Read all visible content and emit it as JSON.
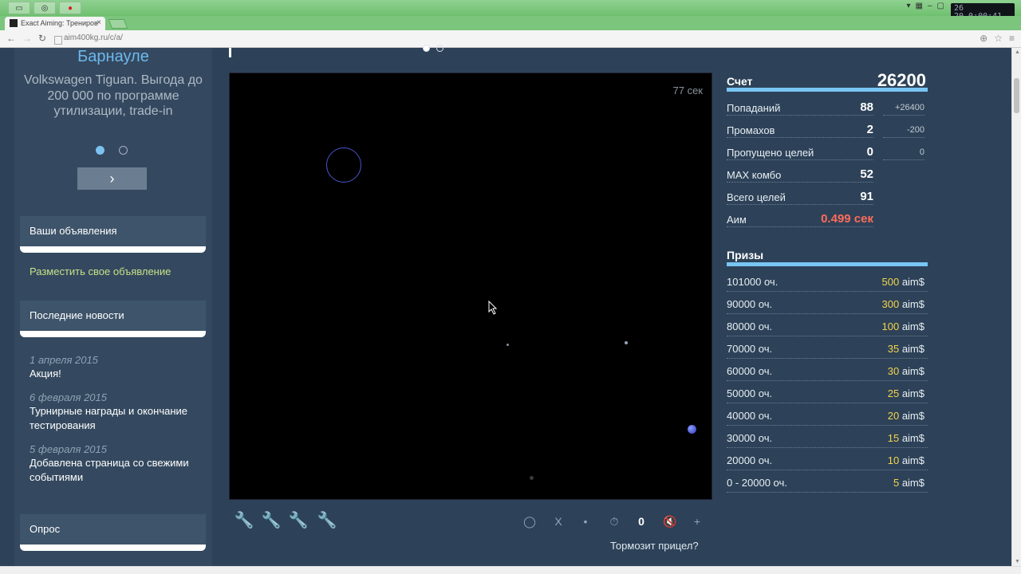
{
  "browser": {
    "tab_title": "Exact Aiming: Трениров",
    "tab_close": "×",
    "url": "aim400kg.ru/c/a/",
    "clock_line1": "20 0:00:41",
    "clock_top": "26"
  },
  "sidebar": {
    "ad_city": "Барнауле",
    "ad_text": "Volkswagen Tiguan. Выгода до 200 000 по программе утилизации, trade-in",
    "ad_next": "›",
    "your_ads": "Ваши объявления",
    "place_ad": "Разместить свое объявление",
    "latest_news": "Последние новости",
    "news": [
      {
        "date": "1 апреля 2015",
        "title": "Акция!"
      },
      {
        "date": "6 февраля 2015",
        "title": "Турнирные награды и окончание тестирования"
      },
      {
        "date": "5 февраля 2015",
        "title": "Добавлена страница со свежими событиями"
      }
    ],
    "poll": "Опрос"
  },
  "game": {
    "timer": "77 сек",
    "counter": "0",
    "close_mark": "X",
    "slow_link": "Тормозит прицел?"
  },
  "stats": {
    "score_label": "Счет",
    "score_value": "26200",
    "rows": [
      {
        "label": "Попаданий",
        "value": "88",
        "delta": "+26400"
      },
      {
        "label": "Промахов",
        "value": "2",
        "delta": "-200"
      },
      {
        "label": "Пропущено целей",
        "value": "0",
        "delta": "0"
      },
      {
        "label": "MAX комбо",
        "value": "52",
        "delta": ""
      },
      {
        "label": "Всего целей",
        "value": "91",
        "delta": ""
      },
      {
        "label": "Аим",
        "value": "0.499 сек",
        "delta": ""
      }
    ]
  },
  "prizes": {
    "title": "Призы",
    "currency": "aim$",
    "rows": [
      {
        "points": "101000 оч.",
        "amount": "500"
      },
      {
        "points": "90000 оч.",
        "amount": "300"
      },
      {
        "points": "80000 оч.",
        "amount": "100"
      },
      {
        "points": "70000 оч.",
        "amount": "35"
      },
      {
        "points": "60000 оч.",
        "amount": "30"
      },
      {
        "points": "50000 оч.",
        "amount": "25"
      },
      {
        "points": "40000 оч.",
        "amount": "20"
      },
      {
        "points": "30000 оч.",
        "amount": "15"
      },
      {
        "points": "20000 оч.",
        "amount": "10"
      },
      {
        "points": "0 - 20000 оч.",
        "amount": "5"
      }
    ]
  },
  "colors": {
    "page_bg": "#2d4258",
    "accent_blue": "#79c5f3",
    "prize_gold": "#f4d44c",
    "aim_red": "#ff6b5b",
    "link_green": "#c8e08a"
  }
}
